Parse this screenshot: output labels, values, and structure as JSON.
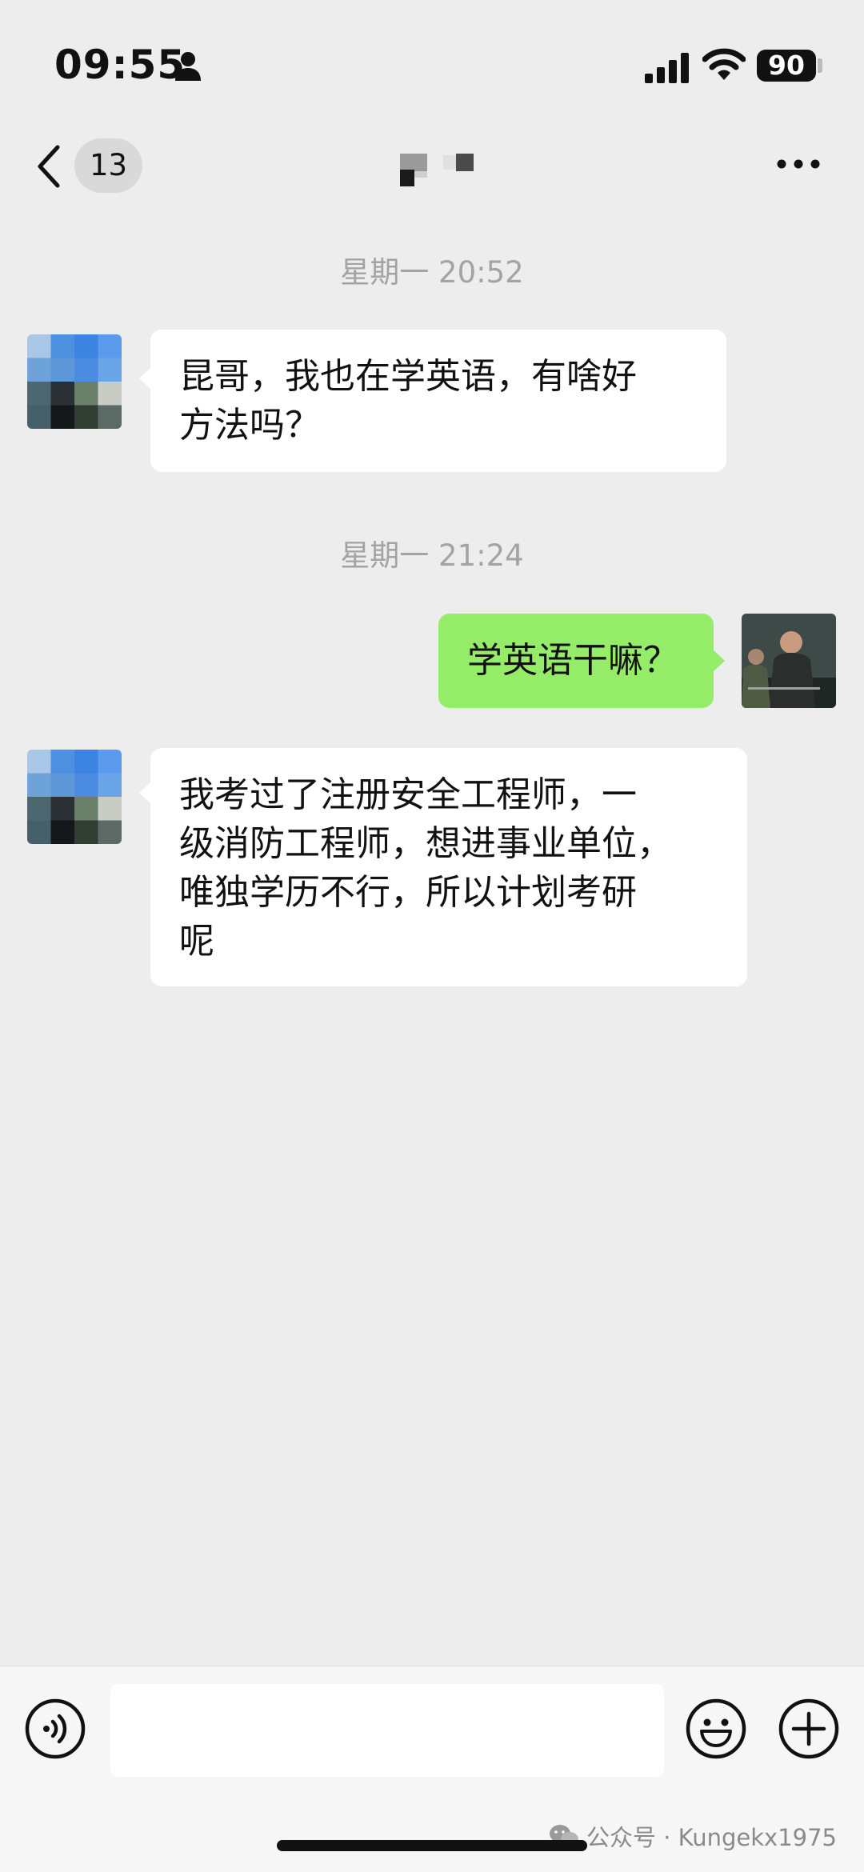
{
  "status_bar": {
    "time": "09:55",
    "battery": "90",
    "icons": [
      "person-icon",
      "signal-icon",
      "wifi-icon",
      "battery-icon"
    ]
  },
  "nav": {
    "back_icon": "chevron-left-icon",
    "unread_count": "13",
    "more_icon": "more-horizontal-icon"
  },
  "messages": [
    {
      "type": "timestamp",
      "text": "星期一 20:52"
    },
    {
      "type": "incoming",
      "lines": [
        "昆哥，我也在学英语，有啥好",
        "方法吗？"
      ]
    },
    {
      "type": "timestamp",
      "text": "星期一 21:24"
    },
    {
      "type": "outgoing",
      "lines": [
        "学英语干嘛？"
      ]
    },
    {
      "type": "incoming",
      "lines": [
        "我考过了注册安全工程师，一",
        "级消防工程师，想进事业单位，",
        "唯独学历不行，所以计划考研",
        "呢"
      ]
    }
  ],
  "input_bar": {
    "voice_icon": "voice-icon",
    "emoji_icon": "emoji-icon",
    "plus_icon": "plus-icon",
    "message_value": ""
  },
  "watermark": {
    "icon": "wechat-icon",
    "text": "公众号 · Kungekx1975"
  },
  "colors": {
    "background": "#ededed",
    "incoming_bubble": "#ffffff",
    "outgoing_bubble": "#95ec69",
    "timestamp": "#a3a3a3"
  }
}
